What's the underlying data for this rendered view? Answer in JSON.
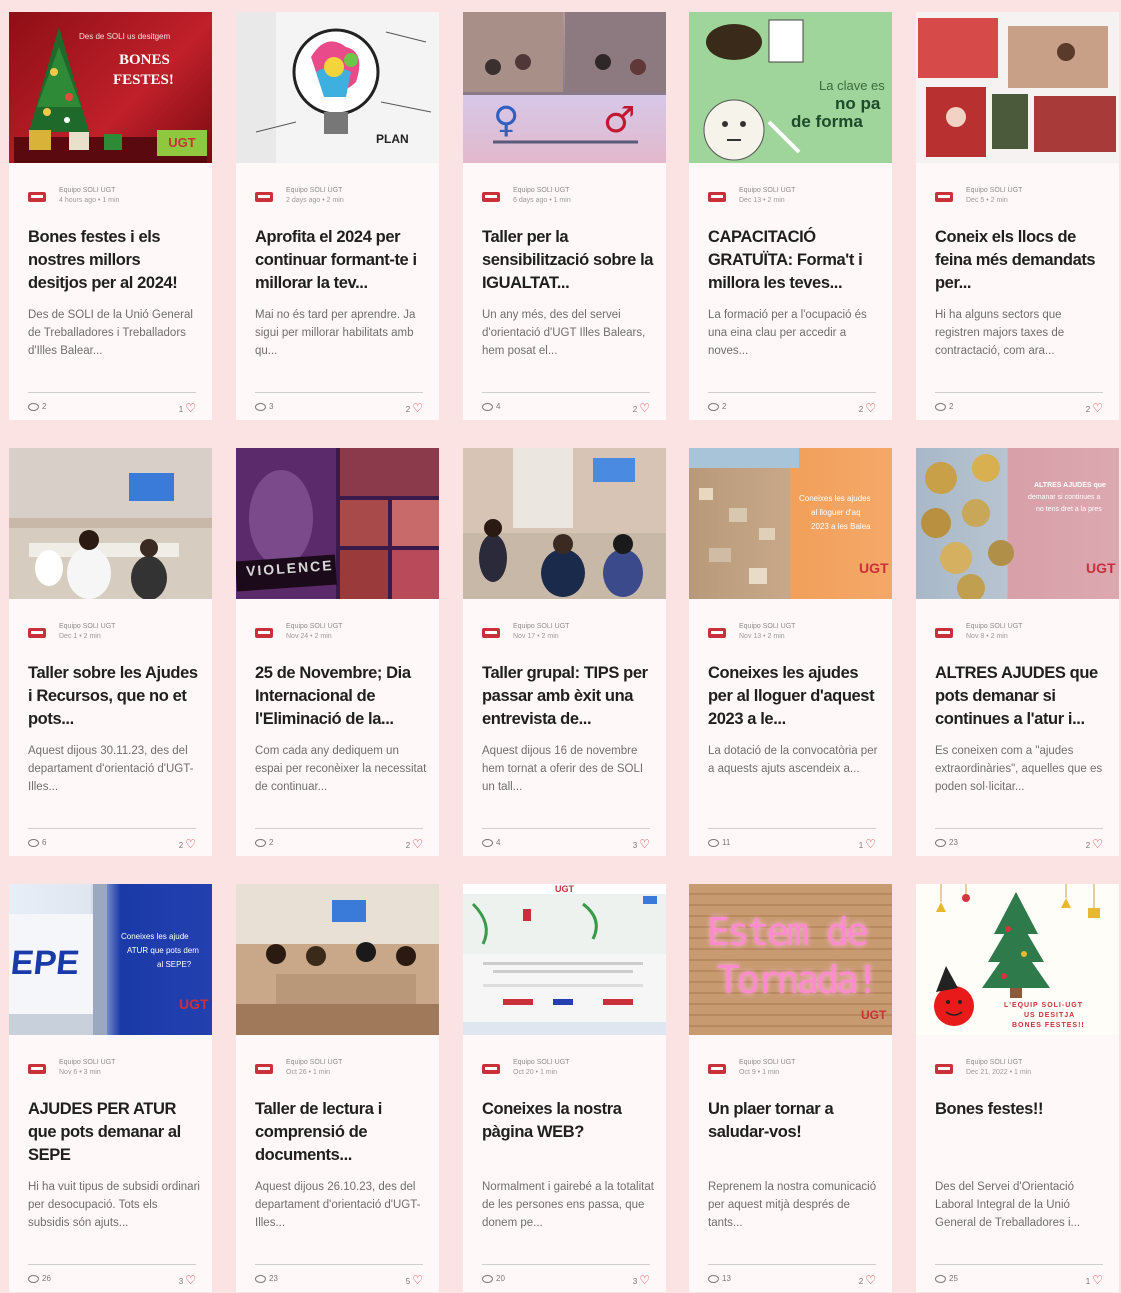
{
  "colors": {
    "page_bg": "#fbe3e3",
    "card_bg": "#fff8f8",
    "heart": "#d8343f",
    "ugt_red": "#c9303a"
  },
  "icons": {
    "comment": "comment-icon",
    "like": "heart-icon",
    "avatar": "ugt-logo-icon"
  },
  "posts": [
    {
      "author": "Equipo SOLI UGT",
      "date": "4 hours ago • 1 min",
      "title": "Bones festes i els nostres millors desitjos per al 2024!",
      "excerpt": "Des de SOLI de la Unió General de Treballadores i Treballadors d'Illes Balear...",
      "comments": "2",
      "likes": "1",
      "img": {
        "line1": "Des de SOLI us desitgem",
        "line2": "BONES",
        "line3": "FESTES!",
        "badge": "UGT"
      }
    },
    {
      "author": "Equipo SOLI UGT",
      "date": "2 days ago • 2 min",
      "title": "Aprofita el 2024 per continuar formant-te i millorar la tev...",
      "excerpt": "Mai no és tard per aprendre. Ja sigui per millorar habilitats amb qu...",
      "comments": "3",
      "likes": "2",
      "img": {
        "label": "PLAN"
      }
    },
    {
      "author": "Equipo SOLI UGT",
      "date": "6 days ago • 1 min",
      "title": "Taller per la sensibilització sobre la IGUALTAT...",
      "excerpt": "Un any més, des del servei d'orientació d'UGT Illes Balears, hem posat el...",
      "comments": "4",
      "likes": "2",
      "img": {
        "female": "♀",
        "male": "♂"
      }
    },
    {
      "author": "Equipo SOLI UGT",
      "date": "Dec 13 • 2 min",
      "title": "CAPACITACIÓ GRATUÏTA: Forma't i millora les teves...",
      "excerpt": "La formació per a l'ocupació és una eina clau per accedir a noves...",
      "comments": "2",
      "likes": "2",
      "img": {
        "line1": "La clave es",
        "line2": "no pa",
        "line3": "de forma"
      }
    },
    {
      "author": "Equipo SOLI UGT",
      "date": "Dec 5 • 2 min",
      "title": "Coneix els llocs de feina més demandats per...",
      "excerpt": "Hi ha alguns sectors que registren majors taxes de contractació, com ara...",
      "comments": "2",
      "likes": "2",
      "img": {}
    },
    {
      "author": "Equipo SOLI UGT",
      "date": "Dec 1 • 2 min",
      "title": "Taller sobre les Ajudes i Recursos, que no et pots...",
      "excerpt": "Aquest dijous 30.11.23, des del departament d'orientació d'UGT-Illes...",
      "comments": "6",
      "likes": "2",
      "img": {}
    },
    {
      "author": "Equipo SOLI UGT",
      "date": "Nov 24 • 2 min",
      "title": "25 de Novembre; Dia Internacional de l'Eliminació de la...",
      "excerpt": "Com cada any dediquem un espai per reconèixer la necessitat de continuar...",
      "comments": "2",
      "likes": "2",
      "img": {
        "label": "VIOLENCE"
      }
    },
    {
      "author": "Equipo SOLI UGT",
      "date": "Nov 17 • 2 min",
      "title": "Taller grupal: TIPS per passar amb èxit una entrevista de...",
      "excerpt": "Aquest dijous 16 de novembre hem tornat a oferir des de SOLI un tall...",
      "comments": "4",
      "likes": "3",
      "img": {}
    },
    {
      "author": "Equipo SOLI UGT",
      "date": "Nov 13 • 2 min",
      "title": "Coneixes les ajudes per al lloguer d'aquest 2023 a le...",
      "excerpt": "La dotació de la convocatòria per a aquests ajuts ascendeix a...",
      "comments": "11",
      "likes": "1",
      "img": {
        "line1": "Coneixes les ajudes",
        "line2": "al lloguer d'aq",
        "line3": "2023 a les Balea",
        "badge": "UGT"
      }
    },
    {
      "author": "Equipo SOLI UGT",
      "date": "Nov 8 • 2 min",
      "title": "ALTRES AJUDES que pots demanar si continues a l'atur i...",
      "excerpt": "Es coneixen com a \"ajudes extraordinàries\", aquelles que es poden sol·licitar...",
      "comments": "23",
      "likes": "2",
      "img": {
        "line1": "ALTRES AJUDES que",
        "line2": "demanar si continues a",
        "line3": "no tens dret a la pres",
        "badge": "UGT"
      }
    },
    {
      "author": "Equipo SOLI UGT",
      "date": "Nov 6 • 3 min",
      "title": "AJUDES PER ATUR que pots demanar al SEPE",
      "excerpt": "Hi ha vuit tipus de subsidi ordinari per desocupació. Tots els subsidis són ajuts...",
      "comments": "26",
      "likes": "3",
      "img": {
        "line1": "Coneixes les ajude",
        "line2": "ATUR que pots dem",
        "line3": "al SEPE?",
        "badge": "UGT",
        "label": "EPE"
      }
    },
    {
      "author": "Equipo SOLI UGT",
      "date": "Oct 26 • 1 min",
      "title": "Taller de lectura i comprensió de documents...",
      "excerpt": "Aquest dijous 26.10.23, des del departament d'orientació d'UGT-Illes...",
      "comments": "23",
      "likes": "5",
      "img": {}
    },
    {
      "author": "Equipo SOLI UGT",
      "date": "Oct 20 • 1 min",
      "title": "Coneixes la nostra pàgina WEB?",
      "excerpt": "Normalment i gairebé a la totalitat de les persones ens passa, que donem pe...",
      "comments": "20",
      "likes": "3",
      "img": {
        "badge": "UGT"
      }
    },
    {
      "author": "Equipo SOLI UGT",
      "date": "Oct 9 • 1 min",
      "title": "Un plaer tornar a saludar-vos!",
      "excerpt": "Reprenem la nostra comunicació per aquest mitjà després de tants...",
      "comments": "13",
      "likes": "2",
      "img": {
        "line1": "Estem de",
        "line2": "Tornada!",
        "badge": "UGT"
      }
    },
    {
      "author": "Equipo SOLI UGT",
      "date": "Dec 21, 2022 • 1 min",
      "title": "Bones festes!!",
      "excerpt": "Des del Servei d'Orientació Laboral Integral de la Unió General de Treballadores i...",
      "comments": "25",
      "likes": "1",
      "img": {
        "line1": "L'EQUIP SOLI-UGT",
        "line2": "US DESITJA",
        "line3": "BONES FESTES!!"
      }
    }
  ]
}
